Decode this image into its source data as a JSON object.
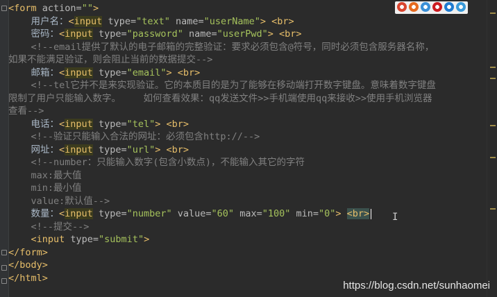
{
  "editor": {
    "lines": [
      [
        {
          "c": "tag",
          "t": "<form "
        },
        {
          "c": "attr",
          "t": "action="
        },
        {
          "c": "val",
          "t": "\"\""
        },
        {
          "c": "tag",
          "t": ">"
        }
      ],
      [
        {
          "c": "txt",
          "t": "    用户名："
        },
        {
          "c": "tag",
          "t": "<"
        },
        {
          "c": "hl",
          "t": "input"
        },
        {
          "c": "tag",
          "t": " "
        },
        {
          "c": "attr",
          "t": "type="
        },
        {
          "c": "val",
          "t": "\"text\""
        },
        {
          "c": "tag",
          "t": " "
        },
        {
          "c": "attr",
          "t": "name="
        },
        {
          "c": "val",
          "t": "\"userName\""
        },
        {
          "c": "tag",
          "t": "> <br>"
        }
      ],
      [
        {
          "c": "txt",
          "t": "    密码："
        },
        {
          "c": "tag",
          "t": "<"
        },
        {
          "c": "hl",
          "t": "input"
        },
        {
          "c": "tag",
          "t": " "
        },
        {
          "c": "attr",
          "t": "type="
        },
        {
          "c": "val",
          "t": "\"password\""
        },
        {
          "c": "tag",
          "t": " "
        },
        {
          "c": "attr",
          "t": "name="
        },
        {
          "c": "val",
          "t": "\"userPwd\""
        },
        {
          "c": "tag",
          "t": "> <br>"
        }
      ],
      [
        {
          "c": "cmt",
          "t": "    <!--email提供了默认的电子邮箱的完整验证：要求必须包含@符号，同时必须包含服务器名称，"
        }
      ],
      [
        {
          "c": "cmt",
          "t": "如果不能满足验证，则会阻止当前的数据提交-->"
        }
      ],
      [
        {
          "c": "txt",
          "t": "    邮箱："
        },
        {
          "c": "tag",
          "t": "<"
        },
        {
          "c": "hl",
          "t": "input"
        },
        {
          "c": "tag",
          "t": " "
        },
        {
          "c": "attr",
          "t": "type="
        },
        {
          "c": "val",
          "t": "\"email\""
        },
        {
          "c": "tag",
          "t": "> <br>"
        }
      ],
      [
        {
          "c": "cmt",
          "t": "    <!--tel它并不是来实现验证。它的本质目的是为了能够在移动端打开数字键盘。意味着数字键盘"
        }
      ],
      [
        {
          "c": "cmt",
          "t": "限制了用户只能输入数字。    如何查看效果：qq发送文件>>手机端使用qq来接收>>使用手机浏览器"
        }
      ],
      [
        {
          "c": "cmt",
          "t": "查看-->"
        }
      ],
      [
        {
          "c": "txt",
          "t": "    电话："
        },
        {
          "c": "tag",
          "t": "<"
        },
        {
          "c": "hl",
          "t": "input"
        },
        {
          "c": "tag",
          "t": " "
        },
        {
          "c": "attr",
          "t": "type="
        },
        {
          "c": "val",
          "t": "\"tel\""
        },
        {
          "c": "tag",
          "t": "> <br>"
        }
      ],
      [
        {
          "c": "cmt",
          "t": "    <!--验证只能输入合法的网址：必须包含http://-->"
        }
      ],
      [
        {
          "c": "txt",
          "t": "    网址："
        },
        {
          "c": "tag",
          "t": "<"
        },
        {
          "c": "hl",
          "t": "input"
        },
        {
          "c": "tag",
          "t": " "
        },
        {
          "c": "attr",
          "t": "type="
        },
        {
          "c": "val",
          "t": "\"url\""
        },
        {
          "c": "tag",
          "t": "> <br>"
        }
      ],
      [
        {
          "c": "cmt",
          "t": "    <!--number：只能输入数字(包含小数点)，不能输入其它的字符"
        }
      ],
      [
        {
          "c": "cmt",
          "t": "    max:最大值"
        }
      ],
      [
        {
          "c": "cmt",
          "t": "    min:最小值"
        }
      ],
      [
        {
          "c": "cmt",
          "t": "    value:默认值-->"
        }
      ],
      [
        {
          "c": "txt",
          "t": "    数量："
        },
        {
          "c": "tag",
          "t": "<"
        },
        {
          "c": "hl",
          "t": "input"
        },
        {
          "c": "tag",
          "t": " "
        },
        {
          "c": "attr",
          "t": "type="
        },
        {
          "c": "val",
          "t": "\"number\""
        },
        {
          "c": "tag",
          "t": " "
        },
        {
          "c": "attr",
          "t": "value="
        },
        {
          "c": "val",
          "t": "\"60\""
        },
        {
          "c": "tag",
          "t": " "
        },
        {
          "c": "attr",
          "t": "max="
        },
        {
          "c": "val",
          "t": "\"100\""
        },
        {
          "c": "tag",
          "t": " "
        },
        {
          "c": "attr",
          "t": "min="
        },
        {
          "c": "val",
          "t": "\"0\""
        },
        {
          "c": "tag",
          "t": "> "
        },
        {
          "c": "brkhl",
          "t": "<br>"
        }
      ],
      [
        {
          "c": "cmt",
          "t": "    <!--提交-->"
        }
      ],
      [
        {
          "c": "tag",
          "t": "    <input "
        },
        {
          "c": "attr",
          "t": "type="
        },
        {
          "c": "val",
          "t": "\"submit\""
        },
        {
          "c": "tag",
          "t": ">"
        }
      ],
      [
        {
          "c": "tag",
          "t": "</form>"
        }
      ],
      [
        {
          "c": "tag",
          "t": "</body>"
        }
      ],
      [
        {
          "c": "tag",
          "t": "</html>"
        }
      ]
    ]
  },
  "browser_icons": [
    {
      "name": "chrome-icon",
      "color": "#d9452f"
    },
    {
      "name": "firefox-icon",
      "color": "#e66a1f"
    },
    {
      "name": "safari-icon",
      "color": "#3a8fd6"
    },
    {
      "name": "opera-icon",
      "color": "#cc1b20"
    },
    {
      "name": "ie-icon",
      "color": "#1f7bd1"
    },
    {
      "name": "edge-icon",
      "color": "#3a9ad9"
    }
  ],
  "watermark": "https://blog.csdn.net/sunhaomei"
}
